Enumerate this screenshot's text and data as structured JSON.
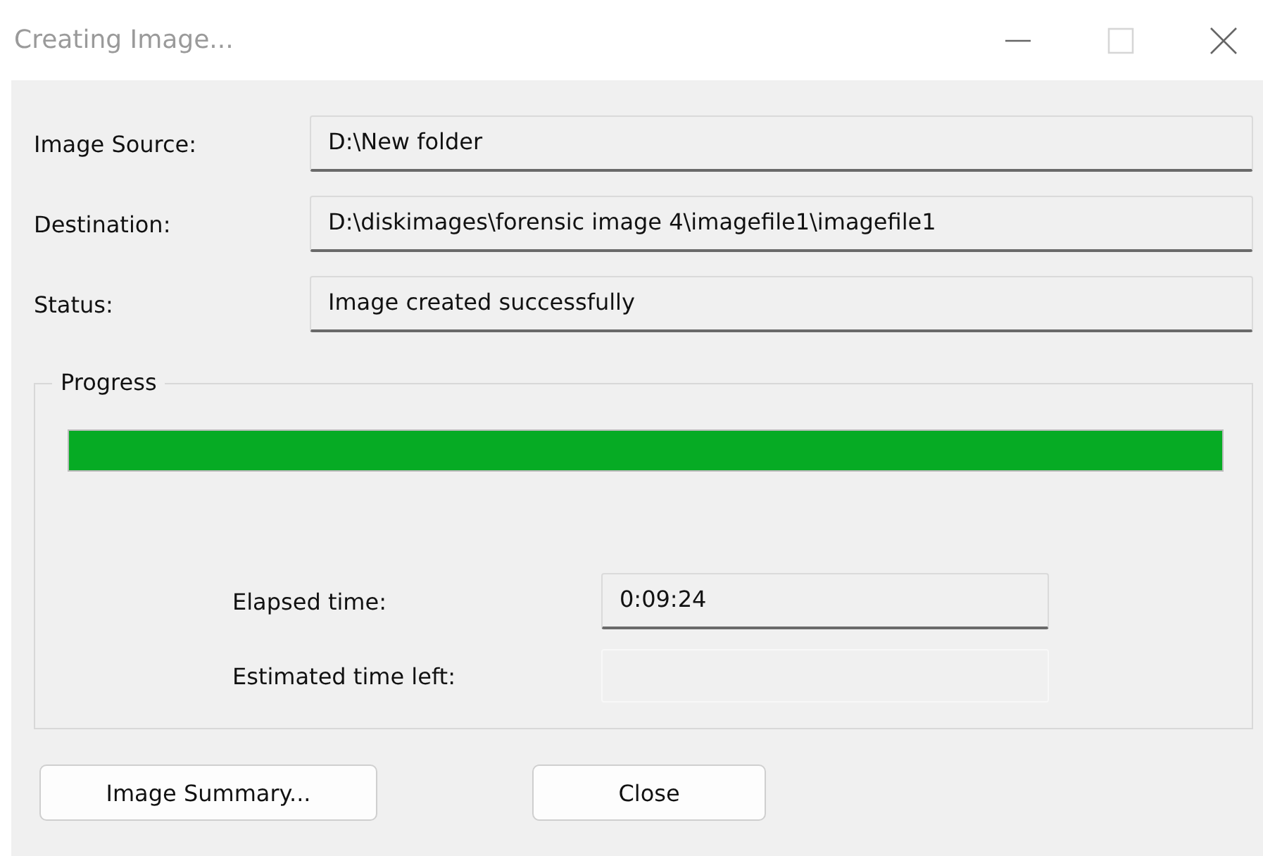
{
  "window": {
    "title": "Creating Image...",
    "controls": [
      {
        "kind": "minimize",
        "disabled": false
      },
      {
        "kind": "maximize",
        "disabled": true
      },
      {
        "kind": "close",
        "disabled": false
      }
    ]
  },
  "fields": [
    {
      "label": "Image Source:",
      "value": "D:\\New folder"
    },
    {
      "label": "Destination:",
      "value": "D:\\diskimages\\forensic image 4\\imagefile1\\imagefile1"
    },
    {
      "label": "Status:",
      "value": "Image created successfully"
    }
  ],
  "progress": {
    "title": "Progress",
    "level": 1,
    "times": [
      {
        "label": "Elapsed time:",
        "value": "0:09:24",
        "disabled": false
      },
      {
        "label": "Estimated time left:",
        "disabled": true
      }
    ]
  },
  "buttons": [
    "Image Summary...",
    "Close"
  ]
}
